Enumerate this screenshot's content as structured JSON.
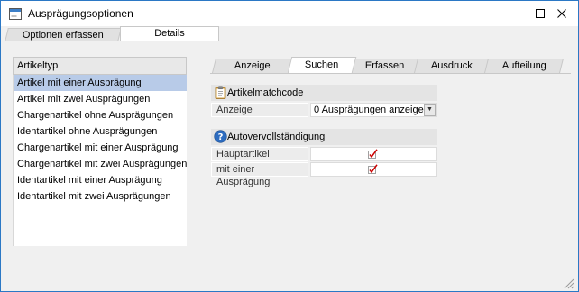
{
  "window": {
    "title": "Ausprägungsoptionen",
    "maximize_icon": "square-icon",
    "close_icon": "close-icon"
  },
  "outer_tabs": [
    {
      "label": "Optionen erfassen",
      "active": false
    },
    {
      "label": "Details",
      "active": true
    }
  ],
  "artikeltyp": {
    "header": "Artikeltyp",
    "items": [
      {
        "label": "Artikel mit einer Ausprägung",
        "selected": true
      },
      {
        "label": "Artikel mit zwei Ausprägungen",
        "selected": false
      },
      {
        "label": "Chargenartikel ohne Ausprägungen",
        "selected": false
      },
      {
        "label": "Identartikel ohne Ausprägungen",
        "selected": false
      },
      {
        "label": "Chargenartikel mit einer Ausprägung",
        "selected": false
      },
      {
        "label": "Chargenartikel mit zwei Ausprägungen",
        "selected": false
      },
      {
        "label": "Identartikel mit einer Ausprägung",
        "selected": false
      },
      {
        "label": "Identartikel mit zwei Ausprägungen",
        "selected": false
      }
    ]
  },
  "inner_tabs": [
    {
      "label": "Anzeige",
      "active": false
    },
    {
      "label": "Suchen",
      "active": true
    },
    {
      "label": "Erfassen",
      "active": false
    },
    {
      "label": "Ausdruck",
      "active": false
    },
    {
      "label": "Aufteilung",
      "active": false
    }
  ],
  "artikelmatchcode": {
    "header": "Artikelmatchcode",
    "icon": "clipboard-icon",
    "rows": [
      {
        "label": "Anzeige",
        "value": "0 Ausprägungen anzeigen"
      }
    ]
  },
  "autovervollstaendigung": {
    "header": "Autovervollständigung",
    "icon": "help-icon",
    "rows": [
      {
        "label": "Hauptartikel",
        "checked": true
      },
      {
        "label": "mit einer Ausprägung",
        "checked": true
      }
    ]
  },
  "colors": {
    "window_border": "#2b78c5",
    "selection": "#b8cbe8",
    "check": "#cc0000"
  }
}
